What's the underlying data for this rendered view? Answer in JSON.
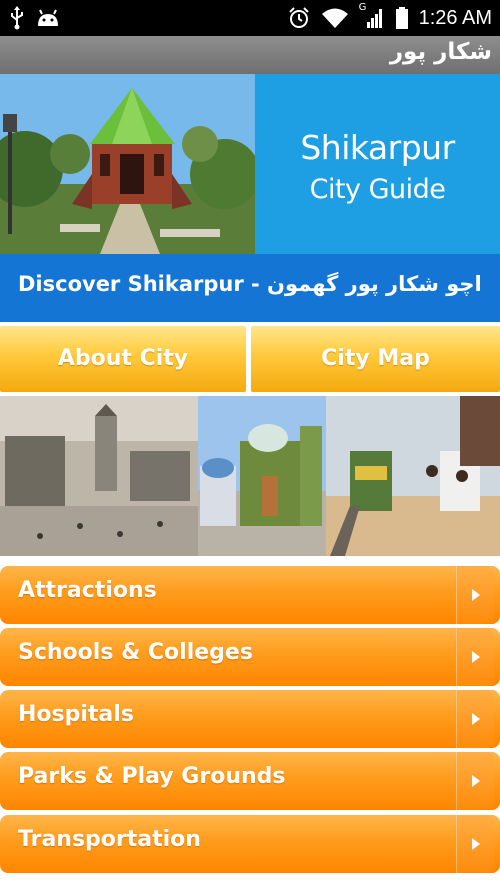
{
  "status_bar": {
    "time": "1:26 AM",
    "network_label": "G",
    "icons": [
      "usb-icon",
      "android-icon",
      "alarm-icon",
      "wifi-icon",
      "signal-icon",
      "battery-icon"
    ]
  },
  "action_bar": {
    "title": "شکار پور"
  },
  "banner": {
    "line1": "Shikarpur",
    "line2": "City Guide",
    "colors": {
      "title_bg": "#1e9fe3"
    }
  },
  "discover": {
    "text": "Discover Shikarpur - اچو شکار پور گھمون",
    "color": "#1575d4"
  },
  "buttons": {
    "about": "About City",
    "map": "City Map"
  },
  "menu": {
    "items": [
      {
        "label": "Attractions"
      },
      {
        "label": "Schools & Colleges"
      },
      {
        "label": "Hospitals"
      },
      {
        "label": "Parks & Play Grounds"
      },
      {
        "label": "Transportation"
      }
    ],
    "accent": "#ff9c1c"
  }
}
